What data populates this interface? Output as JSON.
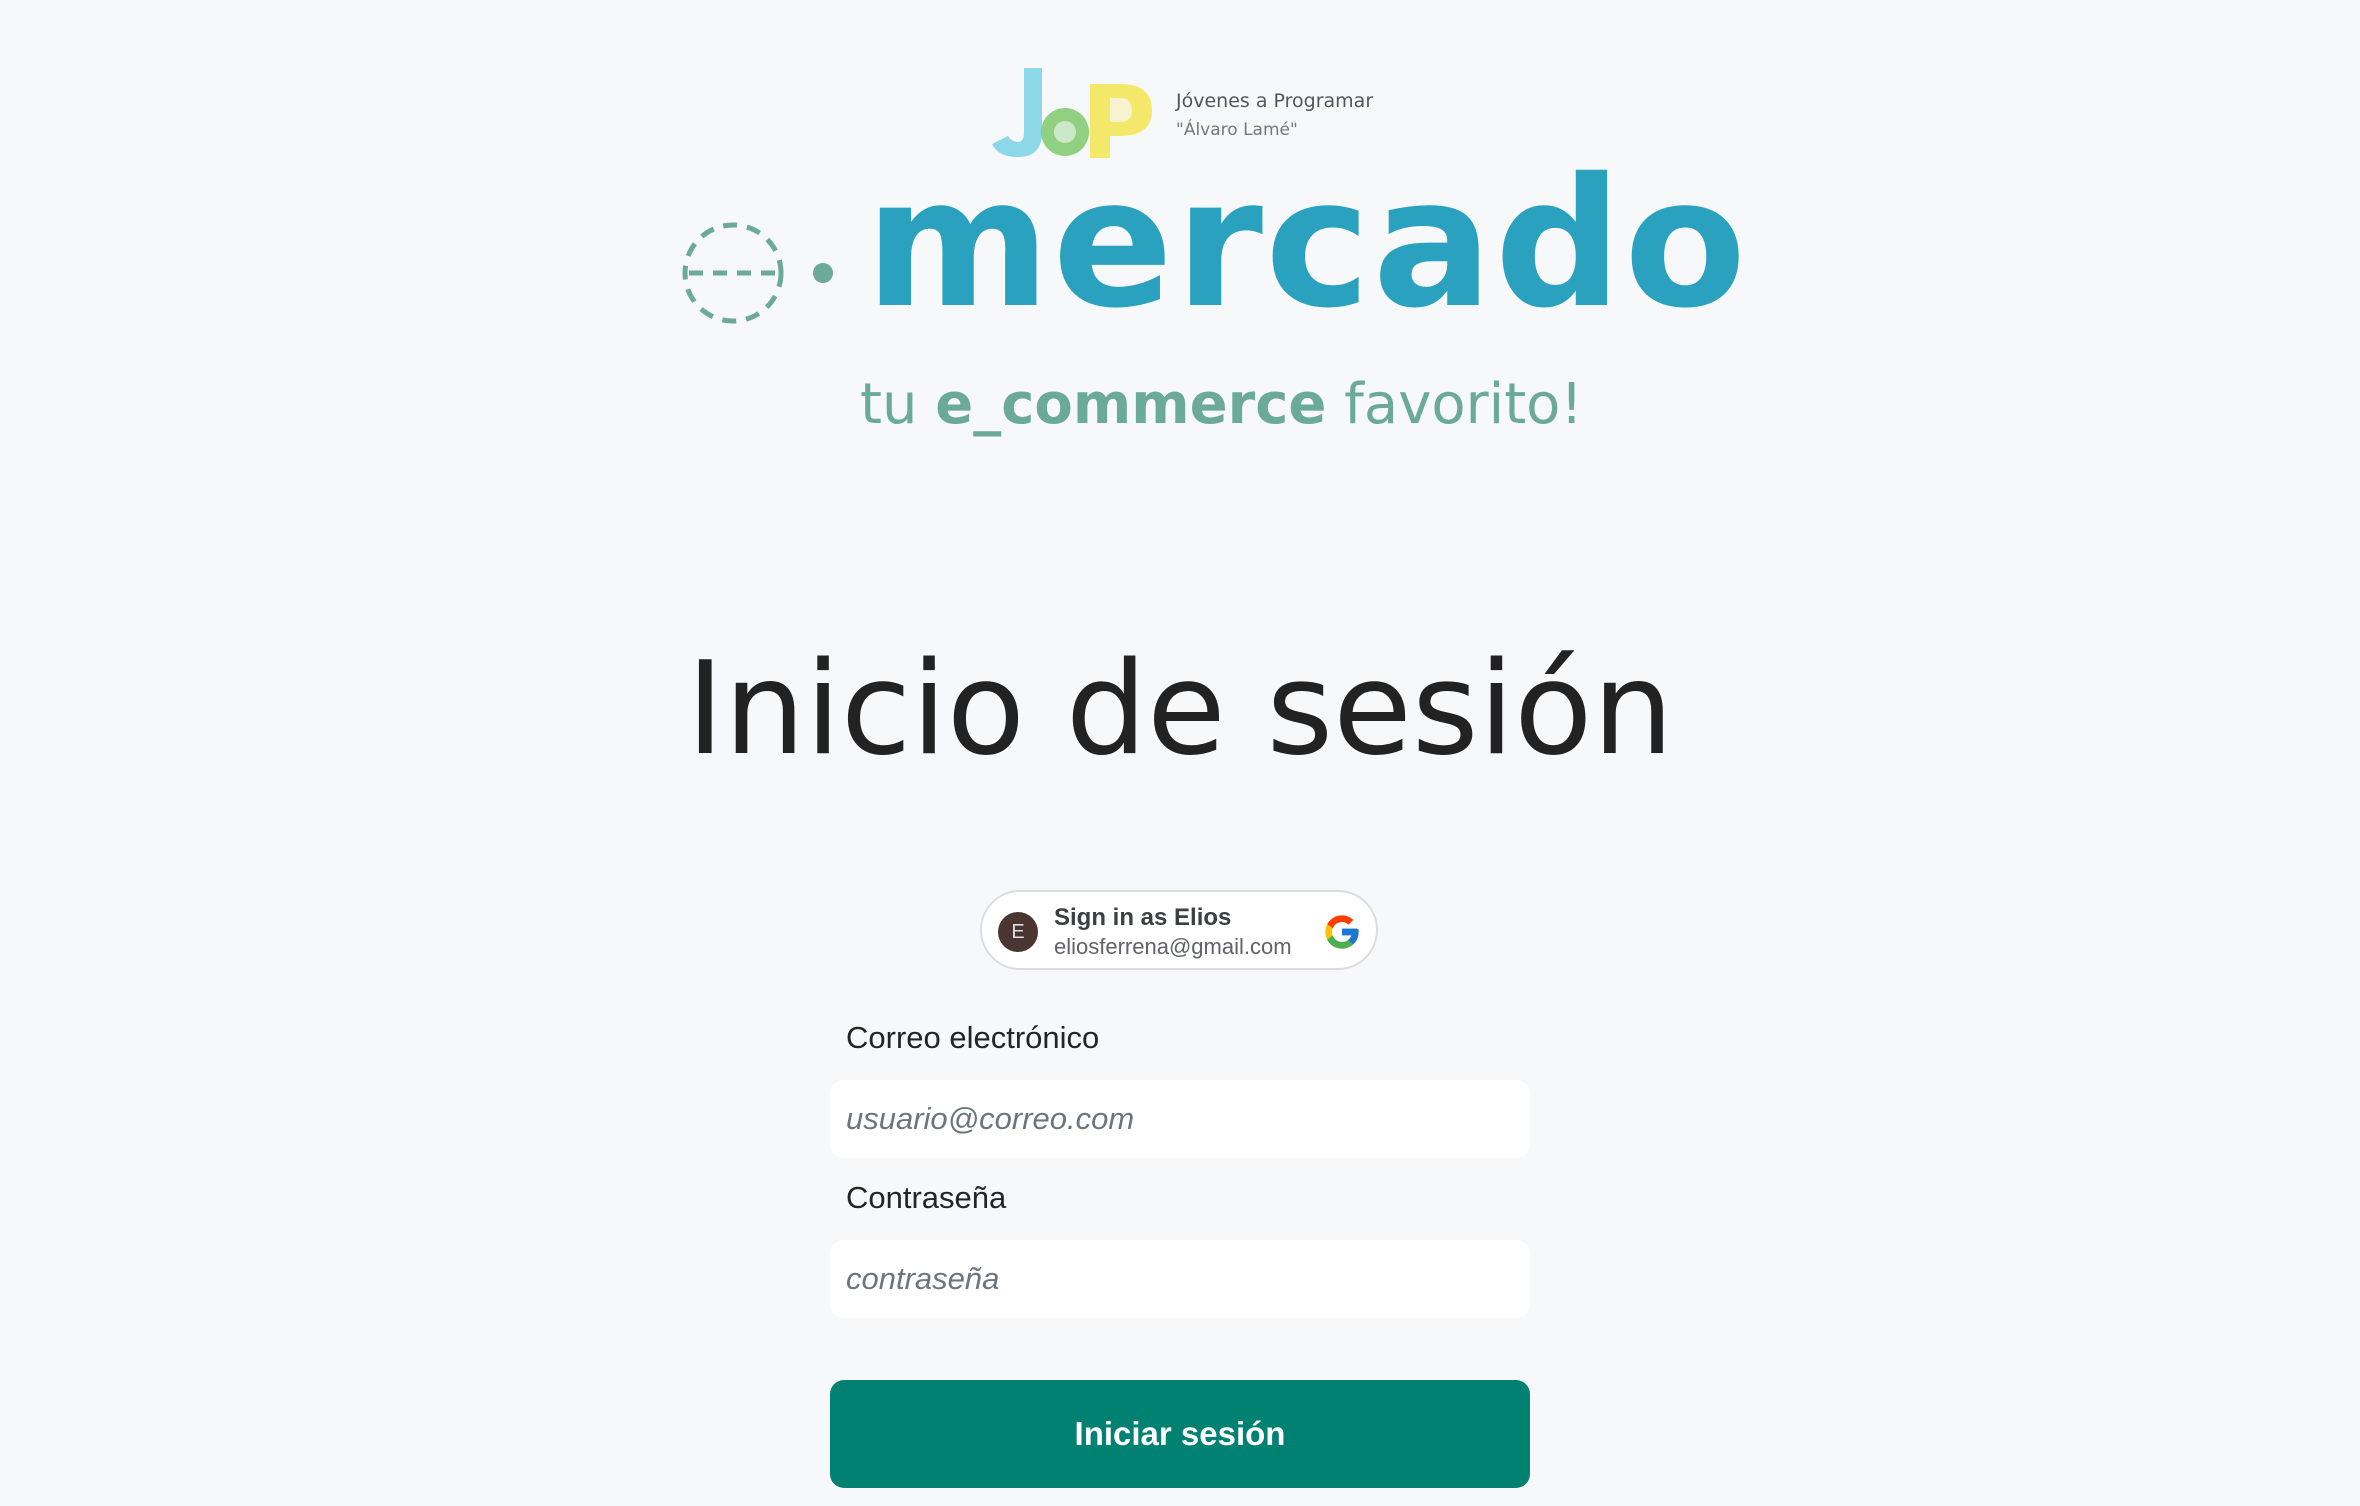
{
  "header": {
    "jap_logo": {
      "letters": "JaP",
      "line1": "Jóvenes a Programar",
      "line2": "\"Álvaro Lamé\""
    },
    "brand": {
      "prefix": "e",
      "name": "mercado"
    },
    "tagline": {
      "part1": "tu ",
      "part2": "e_commerce",
      "part3": " favorito!"
    }
  },
  "page_title": "Inicio de sesión",
  "google_signin": {
    "avatar_initial": "E",
    "label": "Sign in as Elios",
    "email": "eliosferrena@gmail.com",
    "icon": "google-g-icon"
  },
  "form": {
    "email_label": "Correo electrónico",
    "email_placeholder": "usuario@correo.com",
    "email_value": "",
    "password_label": "Contraseña",
    "password_placeholder": "contraseña",
    "password_value": "",
    "submit_label": "Iniciar sesión"
  },
  "colors": {
    "background": "#f7f8fa",
    "brand_blue": "#2aa2bf",
    "brand_green": "#6aaa96",
    "button": "#018172"
  }
}
